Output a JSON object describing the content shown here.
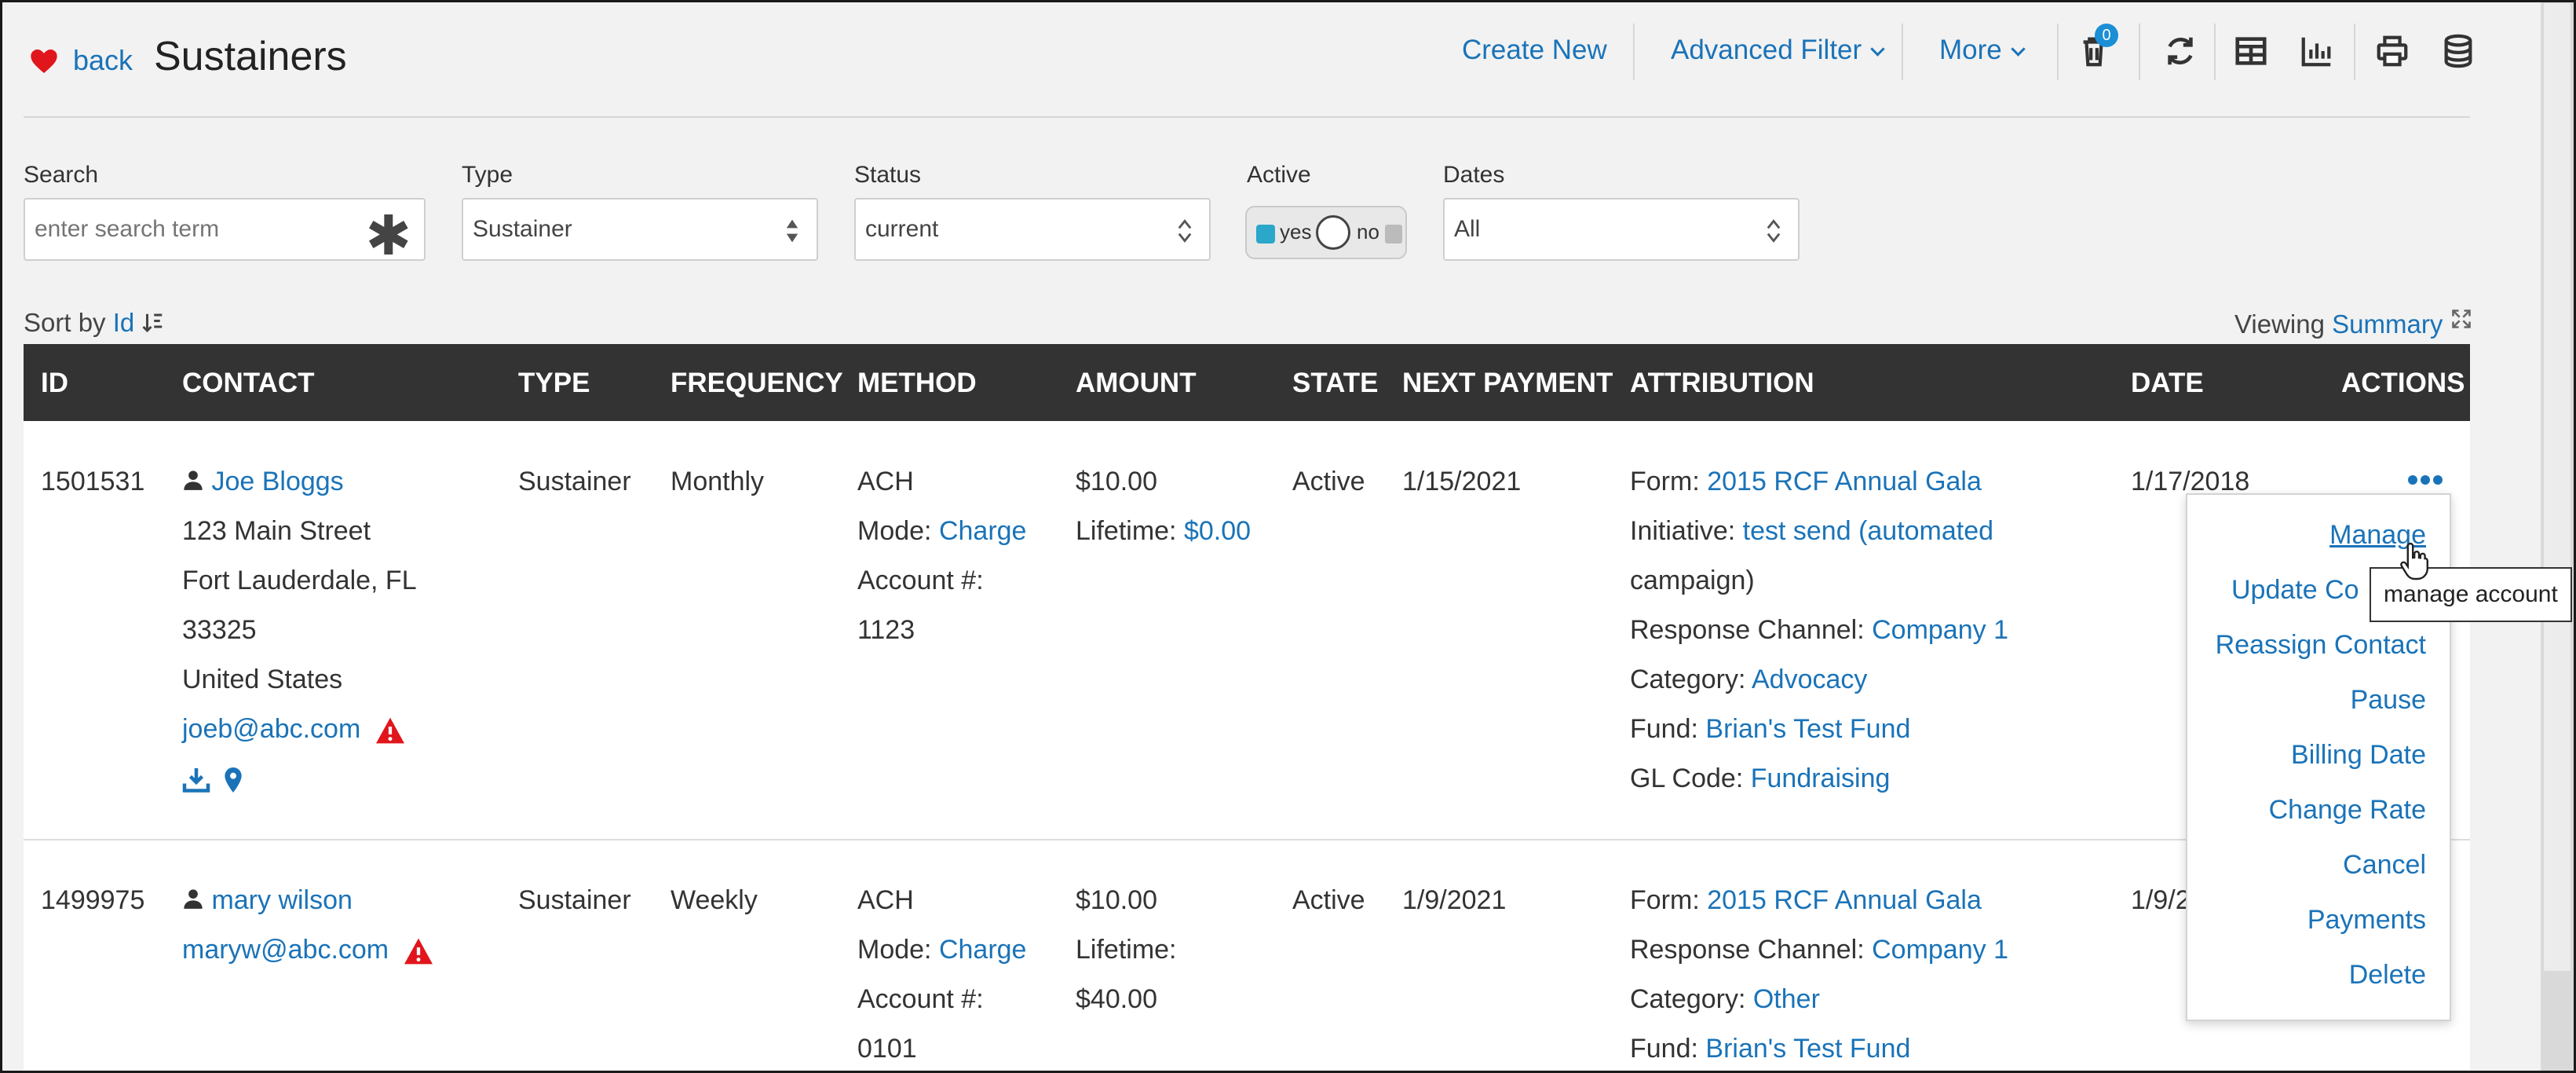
{
  "header": {
    "back_label": "back",
    "title": "Sustainers",
    "create_new": "Create New",
    "advanced_filter": "Advanced Filter",
    "more": "More",
    "trash_badge": "0"
  },
  "filters": {
    "search_label": "Search",
    "search_placeholder": "enter search term",
    "type_label": "Type",
    "type_value": "Sustainer",
    "status_label": "Status",
    "status_value": "current",
    "active_label": "Active",
    "active_yes": "yes",
    "active_no": "no",
    "dates_label": "Dates",
    "dates_value": "All"
  },
  "sort": {
    "prefix": "Sort by",
    "field": "Id"
  },
  "viewing": {
    "prefix": "Viewing",
    "mode": "Summary"
  },
  "columns": [
    "ID",
    "CONTACT",
    "TYPE",
    "FREQUENCY",
    "METHOD",
    "AMOUNT",
    "STATE",
    "NEXT PAYMENT",
    "ATTRIBUTION",
    "DATE",
    "ACTIONS"
  ],
  "rows": [
    {
      "id": "1501531",
      "contact_name": "Joe Bloggs",
      "address1": "123 Main Street",
      "address2": "Fort Lauderdale, FL",
      "address3": "33325",
      "address4": "United States",
      "email": "joeb@abc.com",
      "type": "Sustainer",
      "frequency": "Monthly",
      "method": "ACH",
      "mode_label": "Mode:",
      "mode": "Charge",
      "account_label": "Account #:",
      "account": "1123",
      "amount": "$10.00",
      "lifetime_label": "Lifetime:",
      "lifetime": "$0.00",
      "state": "Active",
      "next_payment": "1/15/2021",
      "form_label": "Form:",
      "form": "2015 RCF Annual Gala",
      "initiative_label": "Initiative:",
      "initiative_a": "test send (automated",
      "initiative_b": "campaign)",
      "channel_label": "Response Channel:",
      "channel": "Company 1",
      "category_label": "Category:",
      "category": "Advocacy",
      "fund_label": "Fund:",
      "fund": "Brian's Test Fund",
      "gl_label": "GL Code:",
      "gl": "Fundraising",
      "date": "1/17/2018"
    },
    {
      "id": "1499975",
      "contact_name": "mary wilson",
      "email": "maryw@abc.com",
      "type": "Sustainer",
      "frequency": "Weekly",
      "method": "ACH",
      "mode_label": "Mode:",
      "mode": "Charge",
      "account_label": "Account #:",
      "account": "0101",
      "amount": "$10.00",
      "lifetime_label": "Lifetime:",
      "lifetime": "$40.00",
      "state": "Active",
      "next_payment": "1/9/2021",
      "form_label": "Form:",
      "form": "2015 RCF Annual Gala",
      "channel_label": "Response Channel:",
      "channel": "Company 1",
      "category_label": "Category:",
      "category": "Other",
      "fund_label": "Fund:",
      "fund": "Brian's Test Fund",
      "date": "1/9/2"
    }
  ],
  "actions_menu": {
    "items": [
      "Manage",
      "Update Co",
      "Reassign Contact",
      "Pause",
      "Billing Date",
      "Change Rate",
      "Cancel",
      "Payments",
      "Delete"
    ],
    "tooltip": "manage account"
  },
  "colors": {
    "link": "#1a73b8",
    "header_bg": "#333333",
    "warning": "#e0161c",
    "heart": "#e0161c"
  }
}
